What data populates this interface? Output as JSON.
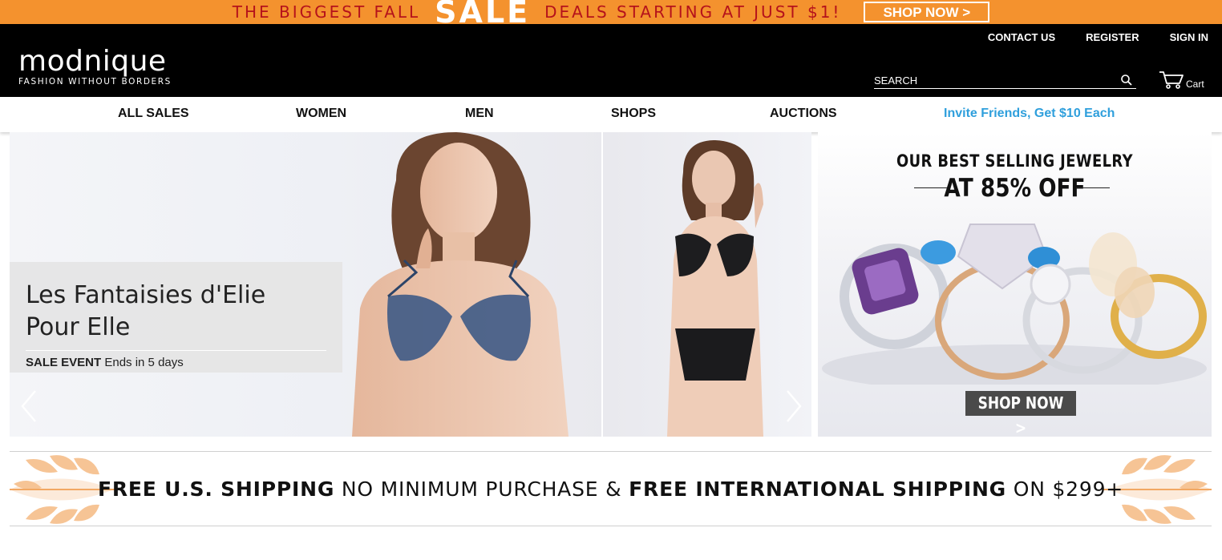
{
  "promo": {
    "text_before": "THE BIGGEST  FALL",
    "sale": "SALE",
    "text_after": "DEALS STARTING AT JUST $1!",
    "button": "SHOP NOW >",
    "bg_color": "#f4922e",
    "text_color": "#b5121b"
  },
  "header": {
    "logo": "modnique",
    "tagline": "FASHION WITHOUT BORDERS",
    "links": {
      "contact": "CONTACT US",
      "register": "REGISTER",
      "signin": "SIGN IN"
    },
    "search_placeholder": "SEARCH",
    "cart_label": "Cart"
  },
  "nav": {
    "all_sales": "ALL SALES",
    "women": "WOMEN",
    "men": "MEN",
    "shops": "SHOPS",
    "auctions": "AUCTIONS",
    "invite": "Invite Friends, Get $10 Each",
    "invite_color": "#2f9fdc"
  },
  "hero": {
    "title_line1": "Les Fantaisies d'Elie",
    "title_line2": "Pour Elle",
    "event_label": "SALE EVENT",
    "event_ends": " Ends in 5 days"
  },
  "jewelry": {
    "headline1": "OUR BEST SELLING JEWELRY",
    "headline2": "AT 85% OFF",
    "button": "SHOP NOW >"
  },
  "shipping": {
    "part1": "FREE U.S. SHIPPING",
    "part2": " NO MINIMUM PURCHASE & ",
    "part3": "FREE INTERNATIONAL SHIPPING",
    "part4": " ON $299+"
  }
}
